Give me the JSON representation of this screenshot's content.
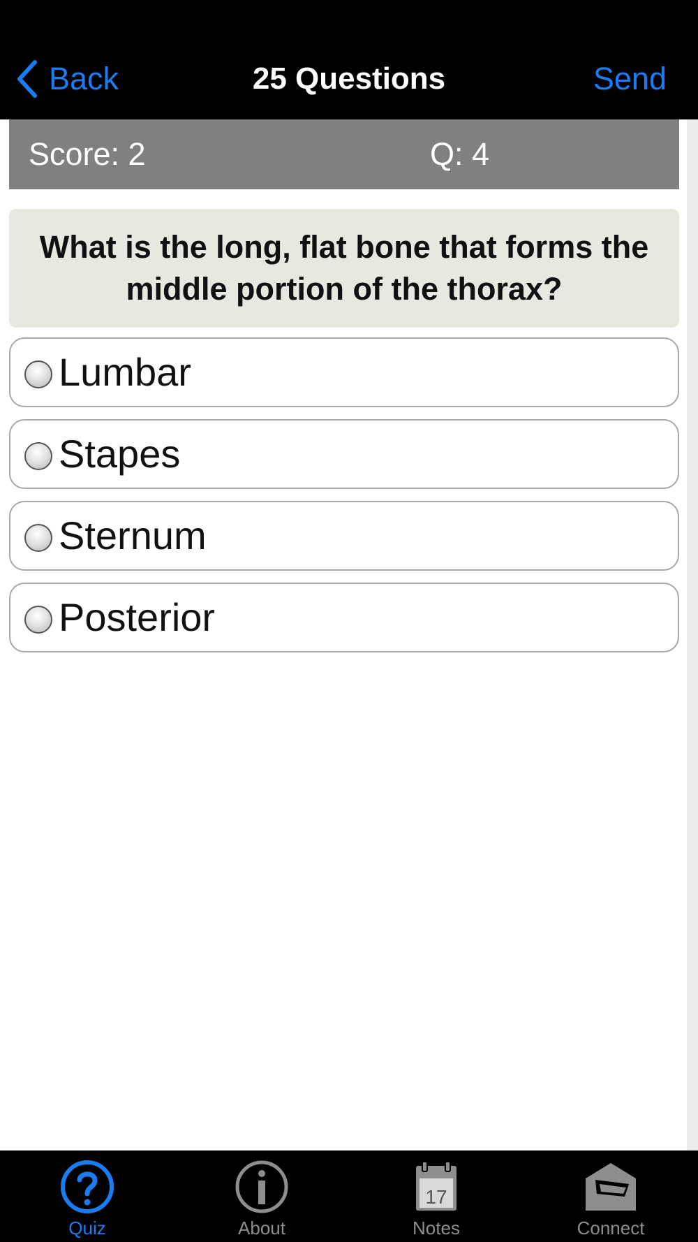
{
  "nav": {
    "back_label": "Back",
    "title": "25 Questions",
    "send_label": "Send"
  },
  "status": {
    "score": "Score: 2",
    "question_number": "Q: 4"
  },
  "question": {
    "text": "What is the long, flat bone that forms the middle portion of the thorax?"
  },
  "answers": [
    {
      "label": "Lumbar",
      "selected": false
    },
    {
      "label": "Stapes",
      "selected": false
    },
    {
      "label": "Sternum",
      "selected": false
    },
    {
      "label": "Posterior",
      "selected": false
    }
  ],
  "tabs": [
    {
      "label": "Quiz",
      "icon": "question-circle-icon",
      "active": true
    },
    {
      "label": "About",
      "icon": "info-circle-icon",
      "active": false
    },
    {
      "label": "Notes",
      "icon": "calendar-icon",
      "active": false,
      "icon_text": "17"
    },
    {
      "label": "Connect",
      "icon": "open-envelope-icon",
      "active": false
    }
  ],
  "colors": {
    "accent": "#1a7cf0",
    "bar_background": "#000000",
    "score_bar": "#808080",
    "question_card": "#e8e8e0",
    "inactive_tab": "#8e8e8e"
  }
}
